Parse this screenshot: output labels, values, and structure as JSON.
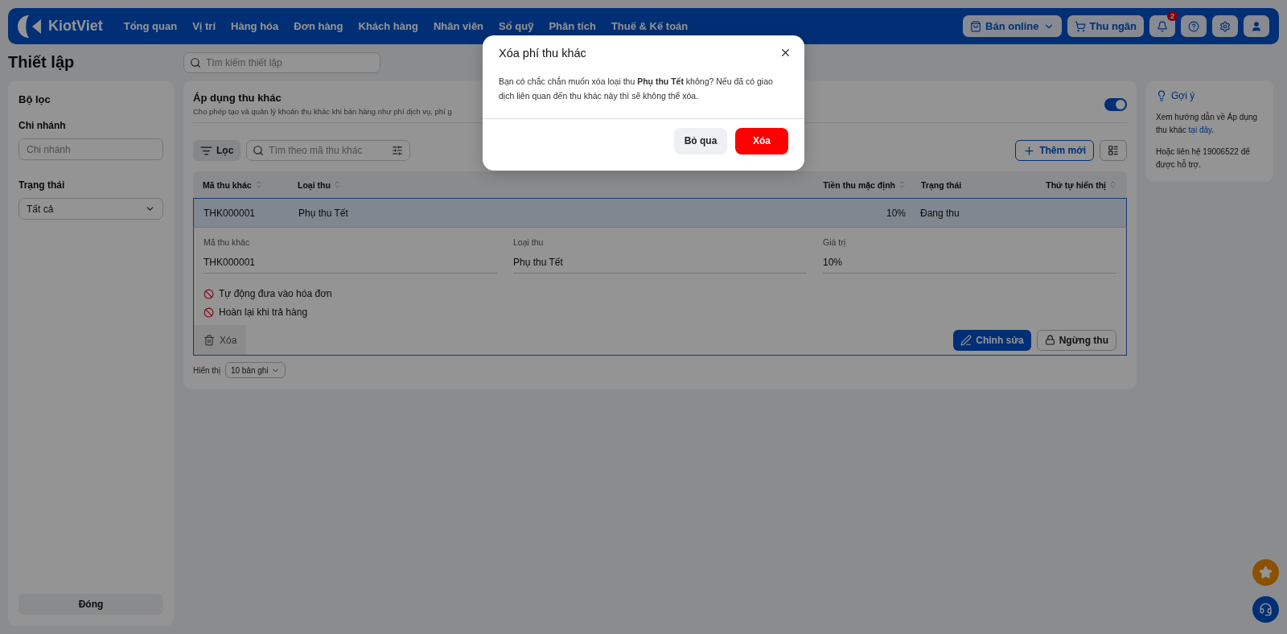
{
  "header": {
    "brand": "KiotViet",
    "nav": [
      "Tổng quan",
      "Vị trí",
      "Hàng hóa",
      "Đơn hàng",
      "Khách hàng",
      "Nhân viên",
      "Sổ quỹ",
      "Phân tích",
      "Thuế & Kế toán"
    ],
    "online_button": "Bán online",
    "cashier_button": "Thu ngân",
    "notification_count": "2"
  },
  "page_title": "Thiết lập",
  "settings_search": {
    "placeholder": "Tìm kiếm thiết lập"
  },
  "filter_panel": {
    "title": "Bộ lọc",
    "filters": [
      {
        "kind": "input",
        "label": "Chi nhánh",
        "placeholder": "Chi nhánh"
      },
      {
        "kind": "select",
        "label": "Trạng thái",
        "value": "Tất cả"
      }
    ],
    "close_button": "Đóng"
  },
  "section": {
    "title": "Áp dụng thu khác",
    "description": "Cho phép tạo và quản lý khoản thu khác khi bán hàng như phí dịch vụ, phí g",
    "enabled": true,
    "filter_button": "Lọc",
    "search": {
      "placeholder": "Tìm theo mã thu khác"
    },
    "add_button": "Thêm mới",
    "table": {
      "columns": [
        {
          "label": "Mã thu khác",
          "sortable": true
        },
        {
          "label": "Loại thu",
          "sortable": true
        },
        {
          "label": "Tiền thu mặc định",
          "sortable": true
        },
        {
          "label": "Trạng thái",
          "sortable": false
        },
        {
          "label": "Thứ tự hiển thị",
          "sortable": true
        }
      ],
      "rows": [
        {
          "selected": true,
          "cells": [
            "THK000001",
            "Phụ thu Tết",
            "10%",
            "Đang thu",
            ""
          ],
          "detail": {
            "fields": [
              {
                "label": "Mã thu khác",
                "value": "THK000001"
              },
              {
                "label": "Loại thu",
                "value": "Phụ thu Tết"
              },
              {
                "label": "Giá trị",
                "value": "10%"
              }
            ],
            "options": [
              {
                "label": "Tự động đưa vào hóa đơn",
                "enabled": false
              },
              {
                "label": "Hoàn lại khi trả hàng",
                "enabled": false
              }
            ],
            "delete_button": {
              "label": "Xóa",
              "hovered": true
            },
            "edit_button": "Chỉnh sửa",
            "stop_button": "Ngừng thu"
          }
        }
      ]
    },
    "page_size_label": "Hiển thị",
    "page_size": "10 bản ghi"
  },
  "hint": {
    "title": "Gợi ý",
    "text": "Xem hướng dẫn về Áp dụng thu khác ",
    "link": "tại đây",
    "text_end": ".",
    "contact": "Hoặc liên hệ 19006522 để được hỗ trợ."
  },
  "dialog": {
    "title": "Xóa phí thu khác",
    "message": "Bạn có chắc chắn muốn xóa loại thu **Phụ thu Tết** không? Nếu đã có giao dịch liên quan đến thu khác này thì sẽ không thể xóa.",
    "cancel": "Bỏ qua",
    "confirm": "Xóa"
  }
}
